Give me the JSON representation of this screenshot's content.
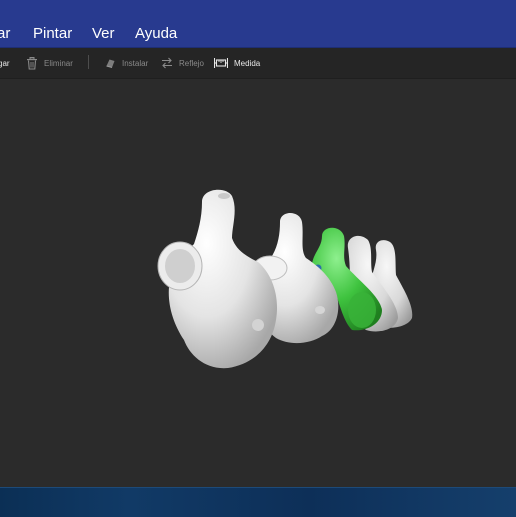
{
  "menu": {
    "items": [
      {
        "id": "menu-cargar",
        "label": "ar"
      },
      {
        "id": "menu-pintar",
        "label": "Pintar"
      },
      {
        "id": "menu-ver",
        "label": "Ver"
      },
      {
        "id": "menu-ayuda",
        "label": "Ayuda"
      }
    ]
  },
  "toolbar": {
    "agregar_label": "gar",
    "eliminar_label": "Eliminar",
    "instalar_label": "Instalar",
    "reflejo_label": "Reflejo",
    "medida_label": "Medida"
  },
  "icons": {
    "eliminar": "trash-icon",
    "instalar": "install-icon",
    "reflejo": "mirror-arrows-icon",
    "medida": "measure-icon"
  },
  "colors": {
    "menubar": "#283a8f",
    "toolbar": "#252525",
    "viewport": "#2b2b2b",
    "model_white": "#e9e9e9",
    "model_selected": "#3fc33f",
    "statusbar": "#113a66"
  },
  "viewport": {
    "model_parts": [
      "part-1",
      "part-2",
      "part-3-selected",
      "part-4",
      "part-5"
    ]
  }
}
